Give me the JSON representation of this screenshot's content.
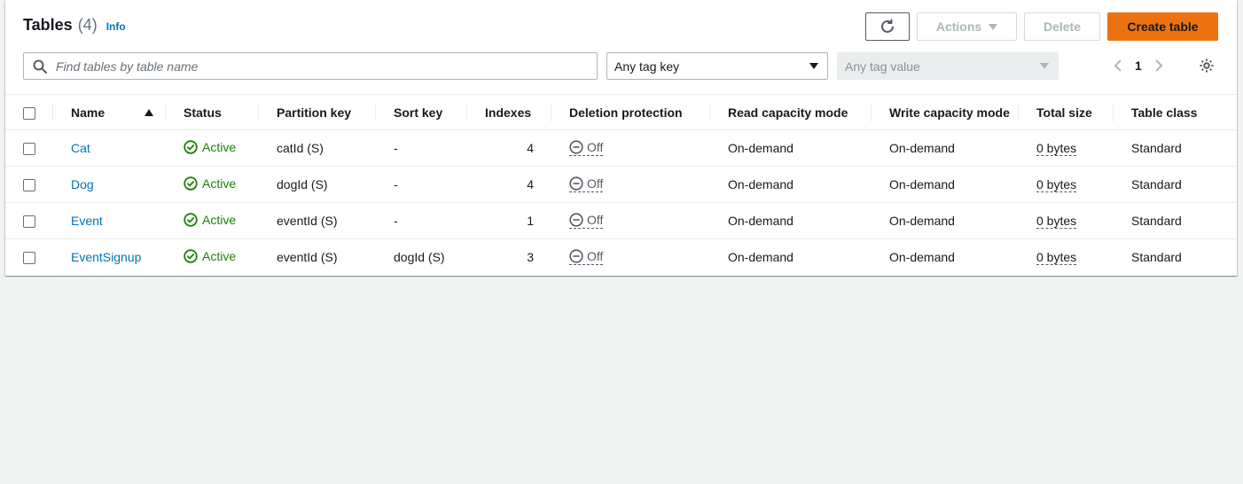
{
  "header": {
    "title": "Tables",
    "count": "(4)",
    "info_label": "Info"
  },
  "toolbar": {
    "actions_label": "Actions",
    "delete_label": "Delete",
    "create_label": "Create table"
  },
  "filters": {
    "search_placeholder": "Find tables by table name",
    "tag_key_value": "Any tag key",
    "tag_value_value": "Any tag value"
  },
  "pagination": {
    "current_page": "1"
  },
  "table": {
    "columns": {
      "name": "Name",
      "status": "Status",
      "partition_key": "Partition key",
      "sort_key": "Sort key",
      "indexes": "Indexes",
      "deletion_protection": "Deletion protection",
      "read_capacity": "Read capacity mode",
      "write_capacity": "Write capacity mode",
      "total_size": "Total size",
      "table_class": "Table class"
    },
    "rows": [
      {
        "name": "Cat",
        "status": "Active",
        "partition_key": "catId (S)",
        "sort_key": "-",
        "indexes": "4",
        "deletion_protection": "Off",
        "read_capacity": "On-demand",
        "write_capacity": "On-demand",
        "total_size": "0 bytes",
        "table_class": "Standard"
      },
      {
        "name": "Dog",
        "status": "Active",
        "partition_key": "dogId (S)",
        "sort_key": "-",
        "indexes": "4",
        "deletion_protection": "Off",
        "read_capacity": "On-demand",
        "write_capacity": "On-demand",
        "total_size": "0 bytes",
        "table_class": "Standard"
      },
      {
        "name": "Event",
        "status": "Active",
        "partition_key": "eventId (S)",
        "sort_key": "-",
        "indexes": "1",
        "deletion_protection": "Off",
        "read_capacity": "On-demand",
        "write_capacity": "On-demand",
        "total_size": "0 bytes",
        "table_class": "Standard"
      },
      {
        "name": "EventSignup",
        "status": "Active",
        "partition_key": "eventId (S)",
        "sort_key": "dogId (S)",
        "indexes": "3",
        "deletion_protection": "Off",
        "read_capacity": "On-demand",
        "write_capacity": "On-demand",
        "total_size": "0 bytes",
        "table_class": "Standard"
      }
    ]
  },
  "icons": {
    "refresh": "refresh-icon",
    "search": "search-icon",
    "settings": "gear-icon",
    "status_active": "check-circle-icon",
    "protection_off": "minus-circle-icon",
    "sort": "sort-ascending-icon"
  },
  "colors": {
    "primary": "#ec7211",
    "link": "#0073bb",
    "success": "#1d8102",
    "background": "#f2f3f3"
  }
}
